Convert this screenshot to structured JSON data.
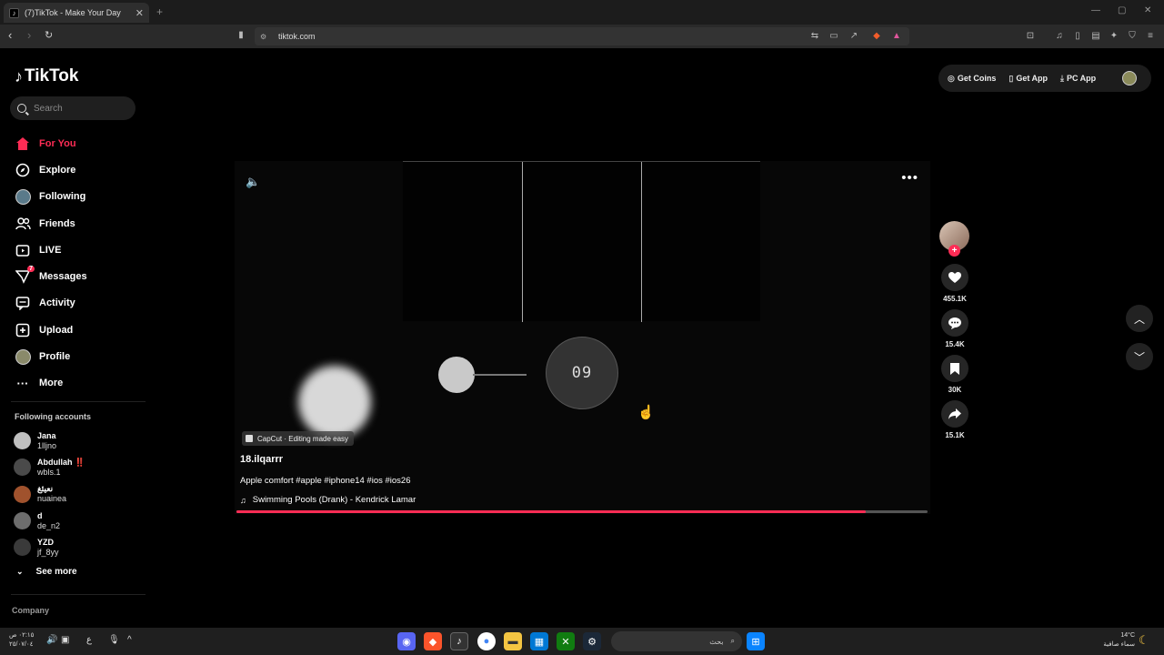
{
  "browser": {
    "tab_title": "(7)TikTok - Make Your Day",
    "tab_close": "✕",
    "new_tab": "+",
    "url": "tiktok.com",
    "window_controls": [
      "—",
      "▢",
      "✕"
    ]
  },
  "sidebar": {
    "logo": "TikTok",
    "search_placeholder": "Search",
    "nav": [
      {
        "label": "For You",
        "icon": "home-icon",
        "glyph": "⌂"
      },
      {
        "label": "Explore",
        "icon": "compass-icon",
        "glyph": "◎"
      },
      {
        "label": "Following",
        "icon": "following-avatar-icon",
        "glyph": ""
      },
      {
        "label": "Friends",
        "icon": "friends-icon",
        "glyph": "👥"
      },
      {
        "label": "LIVE",
        "icon": "live-icon",
        "glyph": "▣"
      },
      {
        "label": "Messages",
        "icon": "messages-icon",
        "glyph": "▽",
        "badge": "7"
      },
      {
        "label": "Activity",
        "icon": "activity-icon",
        "glyph": "☐"
      },
      {
        "label": "Upload",
        "icon": "upload-icon",
        "glyph": "⊞"
      },
      {
        "label": "Profile",
        "icon": "profile-avatar-icon",
        "glyph": ""
      },
      {
        "label": "More",
        "icon": "more-icon",
        "glyph": "···"
      }
    ],
    "following_title": "Following accounts",
    "accounts": [
      {
        "name": "Jana",
        "id": "1lljno",
        "color": "#bfbfbf"
      },
      {
        "name": "Abdullah ‼️",
        "id": "wbls.1",
        "color": "#4a4a4a"
      },
      {
        "name": "نعيئغ",
        "id": "nuainea",
        "color": "#a0522d"
      },
      {
        "name": "d",
        "id": "de_n2",
        "color": "#6d6d6d"
      },
      {
        "name": "YZD",
        "id": "jf_8yy",
        "color": "#3a3a3a"
      }
    ],
    "see_more": "See more",
    "company": "Company"
  },
  "header": {
    "get_coins": "Get Coins",
    "get_app": "Get App",
    "pc_app": "PC App"
  },
  "video": {
    "counter": "09",
    "capcut": "CapCut · Editing made easy",
    "author": "18.ilqarrr",
    "description": "Apple comfort #apple #iphone14 #ios #ios26",
    "music": "Swimming Pools (Drank) - Kendrick Lamar",
    "progress": 0.91
  },
  "actions": {
    "likes": "455.1K",
    "comments": "15.4K",
    "saves": "30K",
    "shares": "15.1K"
  },
  "taskbar": {
    "clock_time": "٠٢:١٥ ص",
    "clock_date": "٢٥/٠٧/٠٤",
    "lang": "ع",
    "search_label": "بحث",
    "temp": "14°C",
    "weather": "سماء صافية"
  }
}
